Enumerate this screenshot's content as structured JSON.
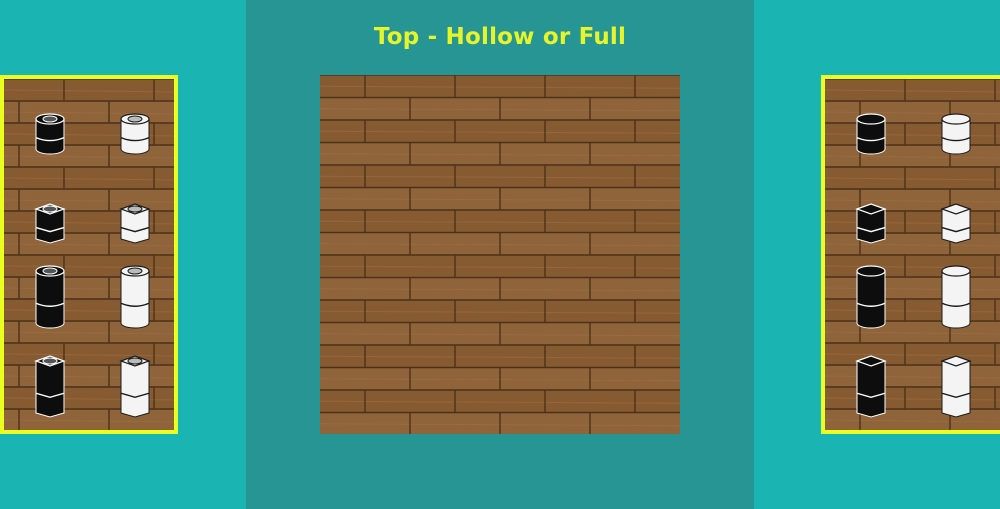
{
  "title": "Top - Hollow or Full",
  "colors": {
    "background": "#1ab5b2",
    "center_panel": "#279593",
    "title": "#e6f52a",
    "panel_border": "#e8ff1f",
    "wood": "#8a6038",
    "wood_line": "#4d3018"
  },
  "left_panel": {
    "top": "hollow",
    "pieces": [
      {
        "color": "black",
        "shape": "round",
        "height": "short",
        "top": "hollow"
      },
      {
        "color": "white",
        "shape": "round",
        "height": "short",
        "top": "hollow"
      },
      {
        "color": "black",
        "shape": "square",
        "height": "short",
        "top": "hollow"
      },
      {
        "color": "white",
        "shape": "square",
        "height": "short",
        "top": "hollow"
      },
      {
        "color": "black",
        "shape": "round",
        "height": "tall",
        "top": "hollow"
      },
      {
        "color": "white",
        "shape": "round",
        "height": "tall",
        "top": "hollow"
      },
      {
        "color": "black",
        "shape": "square",
        "height": "tall",
        "top": "hollow"
      },
      {
        "color": "white",
        "shape": "square",
        "height": "tall",
        "top": "hollow"
      }
    ]
  },
  "right_panel": {
    "top": "full",
    "pieces": [
      {
        "color": "black",
        "shape": "round",
        "height": "short",
        "top": "full"
      },
      {
        "color": "white",
        "shape": "round",
        "height": "short",
        "top": "full"
      },
      {
        "color": "black",
        "shape": "square",
        "height": "short",
        "top": "full"
      },
      {
        "color": "white",
        "shape": "square",
        "height": "short",
        "top": "full"
      },
      {
        "color": "black",
        "shape": "round",
        "height": "tall",
        "top": "full"
      },
      {
        "color": "white",
        "shape": "round",
        "height": "tall",
        "top": "full"
      },
      {
        "color": "black",
        "shape": "square",
        "height": "tall",
        "top": "full"
      },
      {
        "color": "white",
        "shape": "square",
        "height": "tall",
        "top": "full"
      }
    ]
  }
}
